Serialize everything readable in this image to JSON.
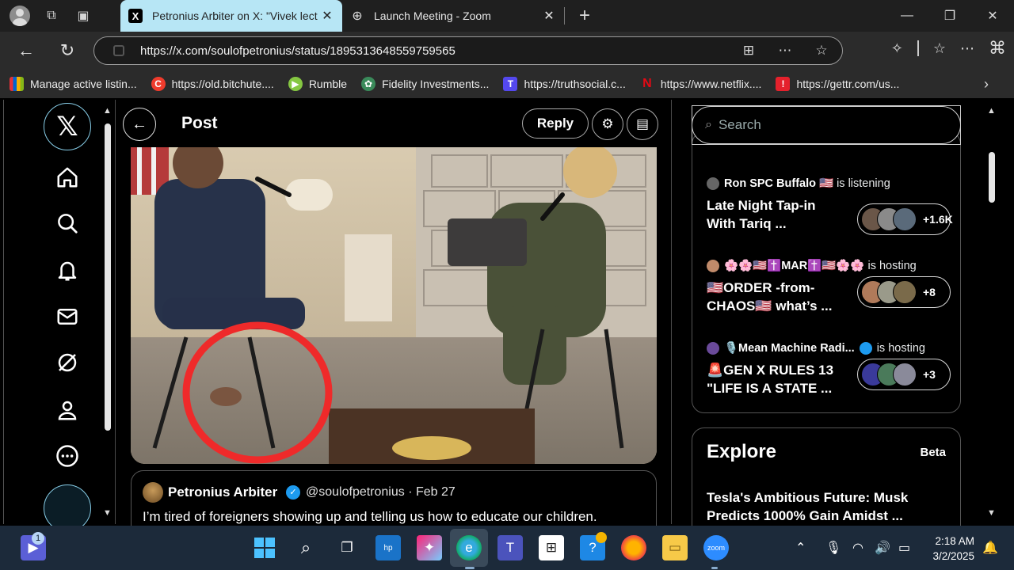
{
  "browser": {
    "tabs": [
      {
        "title": "Petronius Arbiter on X: \"Vivek lect",
        "active": true
      },
      {
        "title": "Launch Meeting - Zoom",
        "active": false
      }
    ],
    "url": "https://x.com/soulofpetronius/status/1895313648559759565",
    "bookmarks": [
      {
        "label": "Manage active listin...",
        "color": "#e53238"
      },
      {
        "label": "https://old.bitchute....",
        "color": "#ef3b2c"
      },
      {
        "label": "Rumble",
        "color": "#85c742"
      },
      {
        "label": "Fidelity Investments...",
        "color": "#3a8a5a"
      },
      {
        "label": "https://truthsocial.c...",
        "color": "#5448ee"
      },
      {
        "label": "https://www.netflix....",
        "color": "#e50914"
      },
      {
        "label": "https://gettr.com/us...",
        "color": "#e5212c"
      }
    ]
  },
  "x": {
    "header": {
      "title": "Post",
      "reply": "Reply"
    },
    "quote": {
      "name": "Petronius Arbiter",
      "handle_date": "@soulofpetronius · Feb 27",
      "text": "I’m tired of foreigners showing up and telling us how to educate our children."
    },
    "search_placeholder": "Search",
    "spaces": [
      {
        "host": "Ron SPC Buffalo 🇺🇸",
        "status": "is listening",
        "title": "Late Night Tap-in With Tariq ...",
        "count": "+1.6K"
      },
      {
        "host": "🌸🌸🇺🇸✝️MAR✝️🇺🇸🌸🌸",
        "status": "is hosting",
        "title": "🇺🇸ORDER -from- CHAOS🇺🇸 what’s ...",
        "count": "+8"
      },
      {
        "host": "🎙️Mean Machine Radi...",
        "status": "is hosting",
        "title": "🚨GEN X RULES 13 \"LIFE IS A STATE ...",
        "count": "+3"
      }
    ],
    "explore": {
      "title": "Explore",
      "beta": "Beta",
      "item": "Tesla's Ambitious Future: Musk Predicts 1000% Gain Amidst ..."
    }
  },
  "taskbar": {
    "time": "2:18 AM",
    "date": "3/2/2025",
    "badge": "1"
  }
}
